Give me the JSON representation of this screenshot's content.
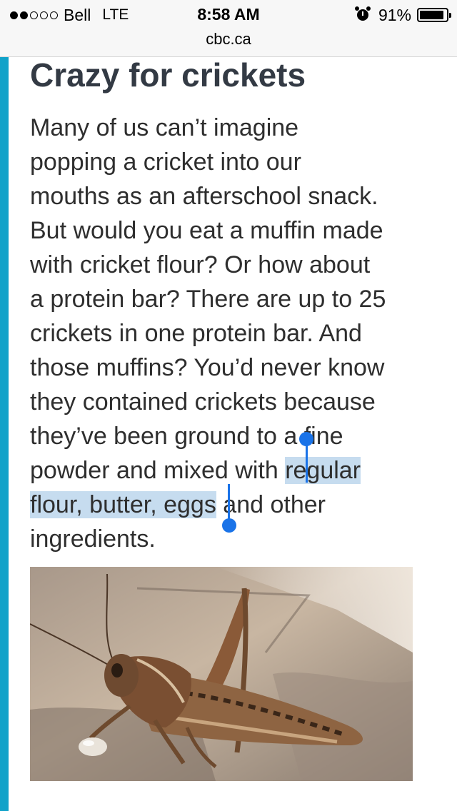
{
  "status_bar": {
    "signal_dots": [
      true,
      true,
      false,
      false,
      false
    ],
    "carrier": "Bell",
    "network": "LTE",
    "time": "8:58 AM",
    "alarm_icon": "alarm-clock-icon",
    "battery_percent": "91%",
    "battery_level": 0.91
  },
  "browser": {
    "url": "cbc.ca"
  },
  "article": {
    "headline": "Crazy for crickets",
    "lines": [
      "Many of us can’t imagine",
      "popping a cricket into our",
      "mouths as an afterschool snack.",
      "But would you eat a muffin made",
      "with cricket flour? Or how about",
      "a protein bar? There are up to 25",
      "crickets in one protein bar. And",
      "those muffins? You’d never know",
      "they contained crickets because",
      "they’ve been ground to a fine"
    ],
    "line11_before": "powder and mixed with ",
    "line11_selected": "regular",
    "line12_selected": "flour, butter, eggs",
    "line12_after": " and other",
    "line13": "ingredients.",
    "selected_text": "regular flour, butter, eggs"
  },
  "image": {
    "subject": "grasshopper-photo"
  },
  "colors": {
    "accent": "#11a2c9",
    "selection": "#c6dcef",
    "selection_handle": "#1a73e8",
    "headline": "#333a44"
  }
}
